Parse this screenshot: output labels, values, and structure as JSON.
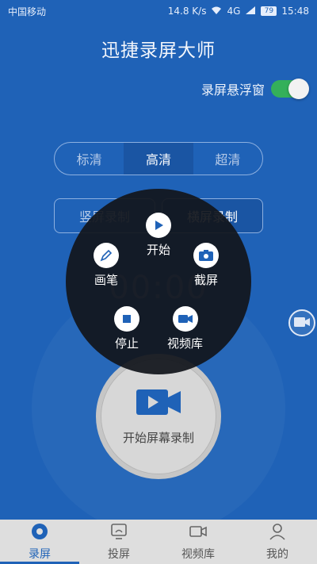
{
  "status_bar": {
    "carrier": "中国移动",
    "speed": "14.8 K/s",
    "network": "4G",
    "battery": "79",
    "time": "15:48"
  },
  "app": {
    "title": "迅捷录屏大师",
    "float_window_label": "录屏悬浮窗",
    "float_window_on": true
  },
  "quality": {
    "options": [
      "标清",
      "高清",
      "超清"
    ],
    "selected": "高清"
  },
  "orientation": {
    "options": [
      "竖屏录制",
      "横屏录制"
    ],
    "selected": "横屏录制"
  },
  "timer": "00:00",
  "record_button_label": "开始屏幕录制",
  "float_menu": {
    "start": "开始",
    "pen": "画笔",
    "screenshot": "截屏",
    "stop": "停止",
    "video_library": "视频库"
  },
  "bottom_nav": {
    "items": [
      {
        "label": "录屏",
        "icon": "record-icon",
        "active": true
      },
      {
        "label": "投屏",
        "icon": "cast-icon",
        "active": false
      },
      {
        "label": "视频库",
        "icon": "video-camera-icon",
        "active": false
      },
      {
        "label": "我的",
        "icon": "person-icon",
        "active": false
      }
    ]
  },
  "colors": {
    "background": "#1f62b7",
    "accent": "#1f62b7",
    "toggle_on": "#34b05a"
  }
}
